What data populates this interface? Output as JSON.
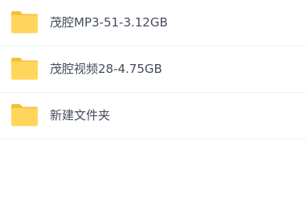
{
  "files": [
    {
      "name": "茂腔MP3-51-3.12GB",
      "icon": "folder-icon"
    },
    {
      "name": "茂腔视频28-4.75GB",
      "icon": "folder-icon"
    },
    {
      "name": "新建文件夹",
      "icon": "folder-icon"
    }
  ],
  "colors": {
    "folder_body": "#ffd55c",
    "folder_tab": "#f5bf3c",
    "text": "#454d5a",
    "divider": "#f1f2f4"
  }
}
